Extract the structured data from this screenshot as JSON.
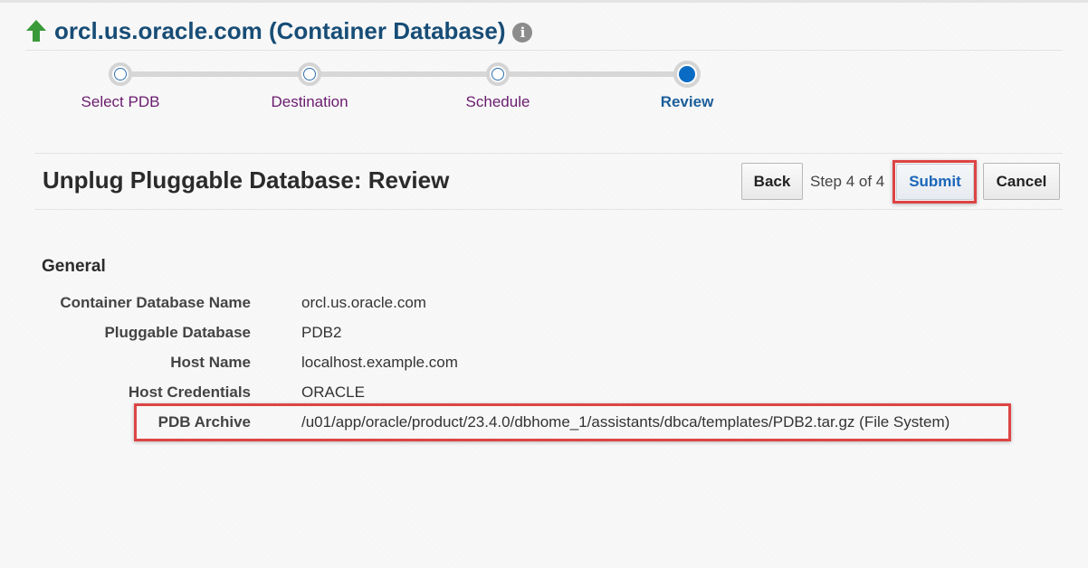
{
  "header": {
    "title": "orcl.us.oracle.com (Container Database)",
    "icon_up": "up-arrow-icon",
    "icon_info": "info-icon",
    "info_glyph": "i"
  },
  "train": {
    "steps": [
      {
        "label": "Select PDB",
        "state": "visited"
      },
      {
        "label": "Destination",
        "state": "visited"
      },
      {
        "label": "Schedule",
        "state": "visited"
      },
      {
        "label": "Review",
        "state": "current"
      }
    ]
  },
  "page": {
    "title": "Unplug Pluggable Database: Review",
    "back_label": "Back",
    "step_counter": "Step 4 of 4",
    "submit_label": "Submit",
    "cancel_label": "Cancel"
  },
  "general": {
    "title": "General",
    "fields": [
      {
        "label": "Container Database Name",
        "value": "orcl.us.oracle.com"
      },
      {
        "label": "Pluggable Database",
        "value": "PDB2"
      },
      {
        "label": "Host Name",
        "value": "localhost.example.com"
      },
      {
        "label": "Host Credentials",
        "value": "ORACLE"
      },
      {
        "label": "PDB Archive",
        "value": "/u01/app/oracle/product/23.4.0/dbhome_1/assistants/dbca/templates/PDB2.tar.gz (File System)"
      }
    ]
  },
  "colors": {
    "title_blue": "#174d76",
    "step_label_purple": "#6a1b6e",
    "current_step_blue": "#0a6bc4",
    "submit_text": "#1a66b8",
    "highlight_red": "#dd4444",
    "arrow_green": "#3a9a3a"
  }
}
